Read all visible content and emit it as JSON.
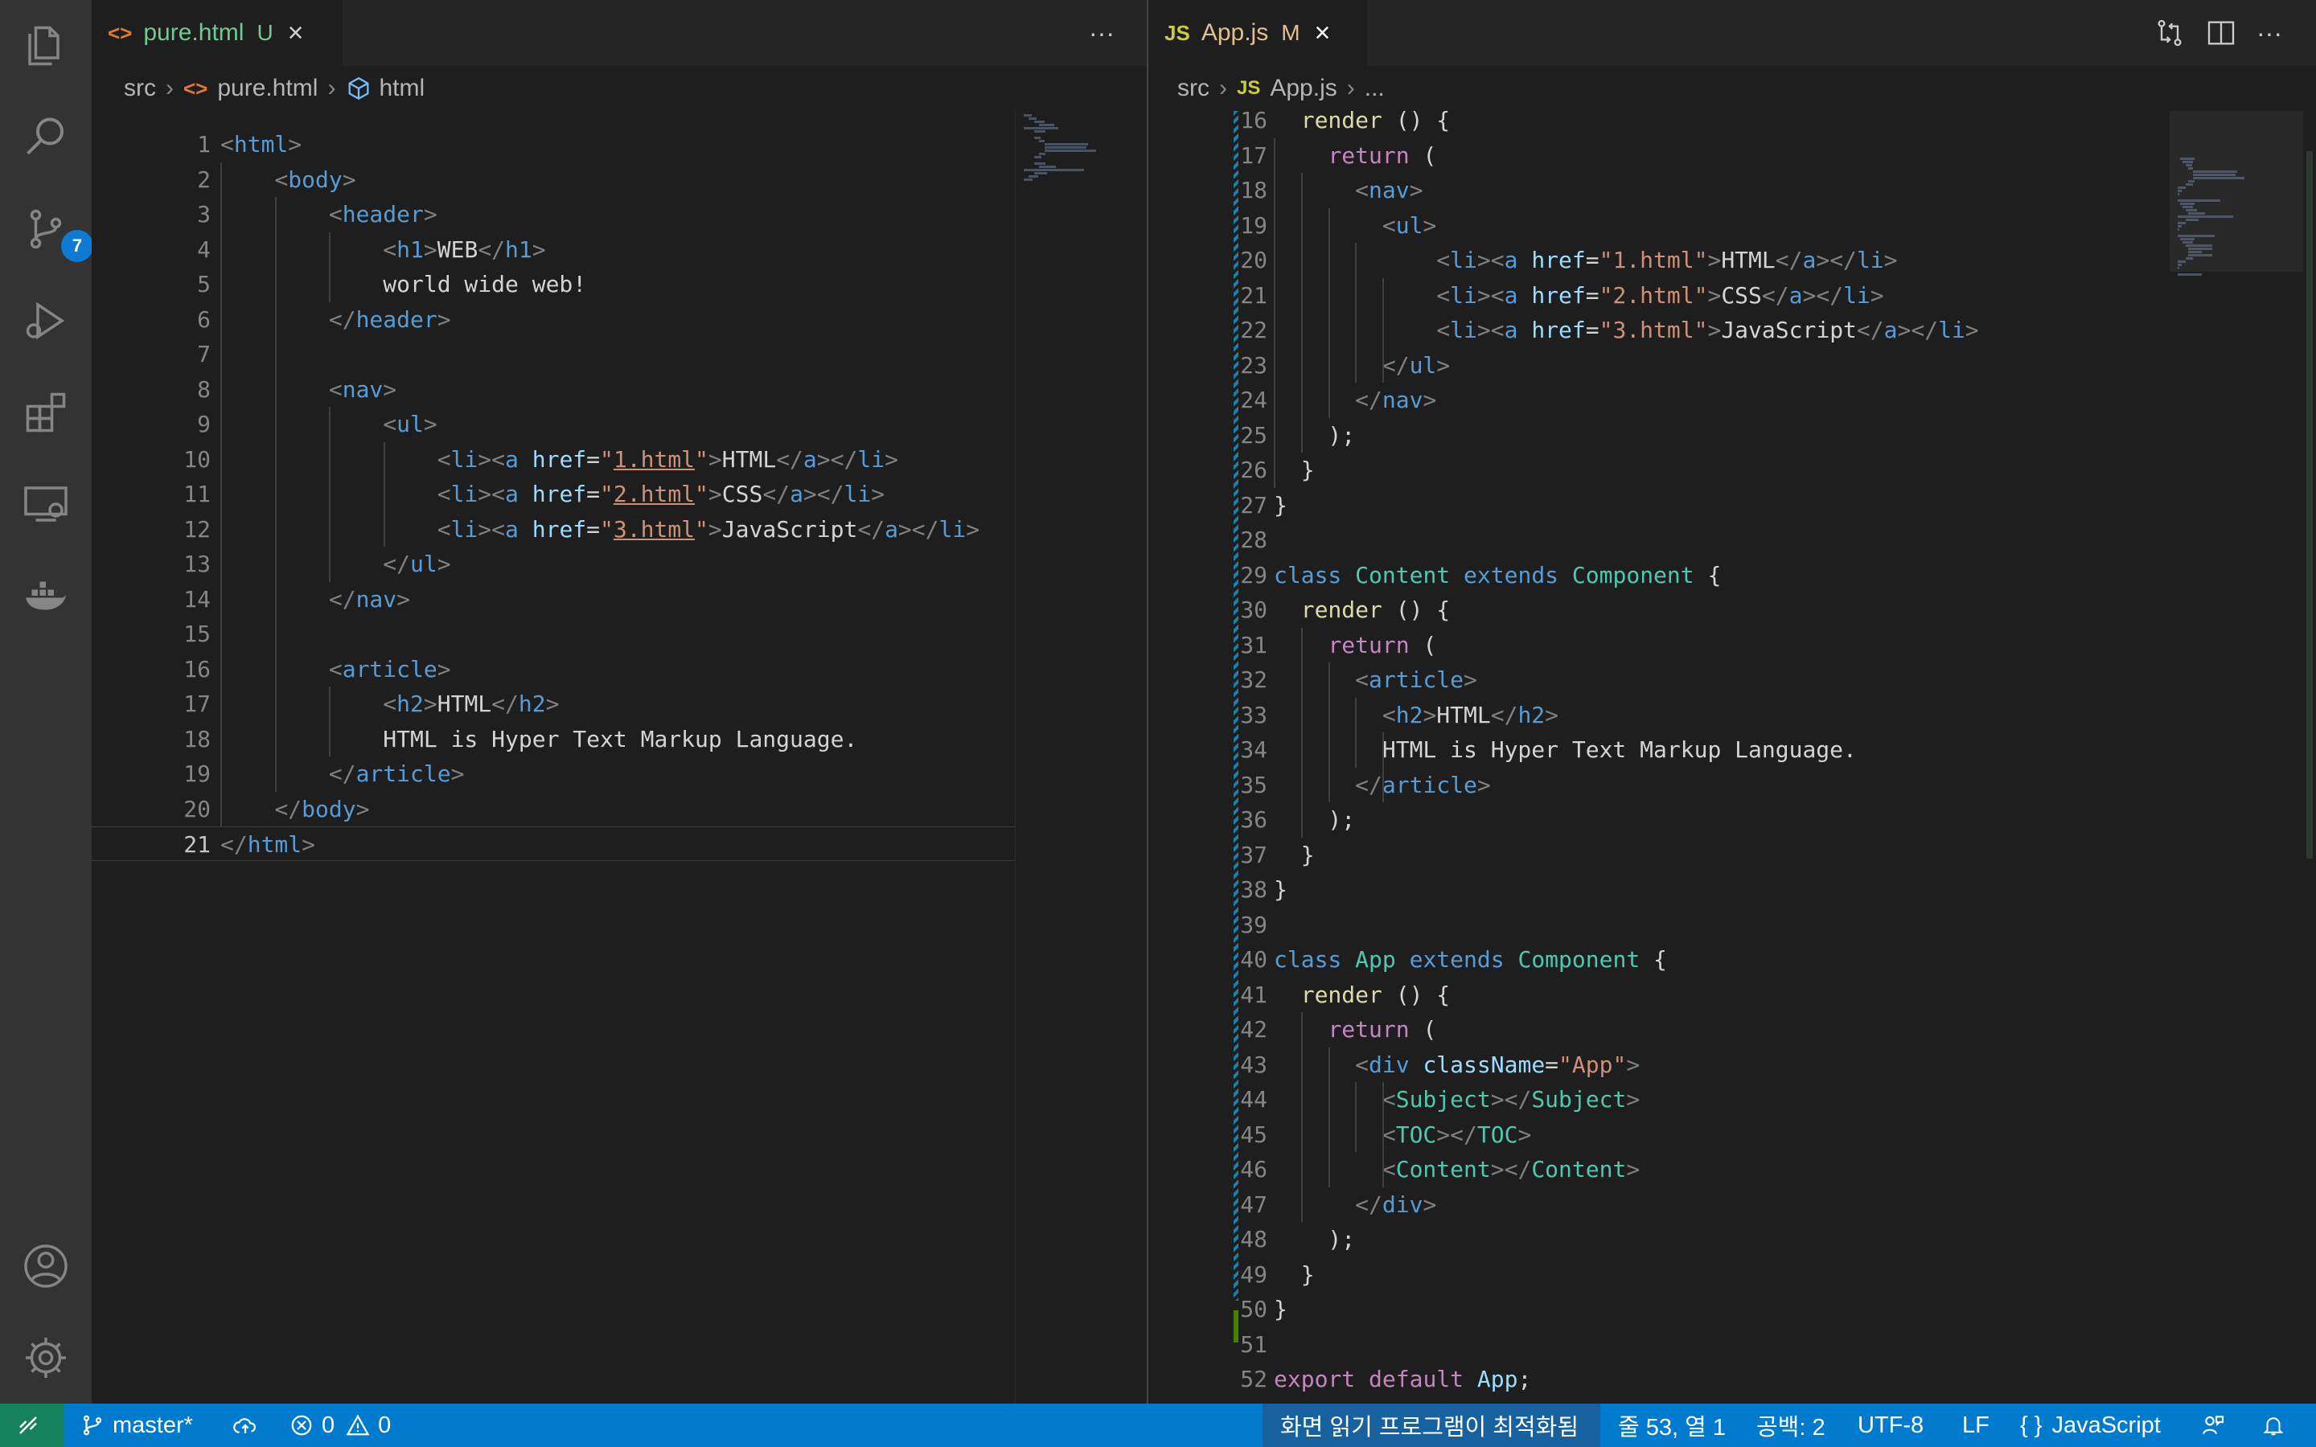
{
  "activity_bar": {
    "source_control_badge": "7"
  },
  "left_editor": {
    "tab": {
      "icon": "<>",
      "filename": "pure.html",
      "status": "U"
    },
    "more_actions": "···",
    "breadcrumb": {
      "folder": "src",
      "file": "pure.html",
      "symbol": "html"
    },
    "active_line": 21,
    "lines": [
      [
        {
          "c": "br",
          "t": "<"
        },
        {
          "c": "t",
          "t": "html"
        },
        {
          "c": "br",
          "t": ">"
        }
      ],
      [
        {
          "c": "pl",
          "t": "    "
        },
        {
          "c": "br",
          "t": "<"
        },
        {
          "c": "t",
          "t": "body"
        },
        {
          "c": "br",
          "t": ">"
        }
      ],
      [
        {
          "c": "pl",
          "t": "        "
        },
        {
          "c": "br",
          "t": "<"
        },
        {
          "c": "t",
          "t": "header"
        },
        {
          "c": "br",
          "t": ">"
        }
      ],
      [
        {
          "c": "pl",
          "t": "            "
        },
        {
          "c": "br",
          "t": "<"
        },
        {
          "c": "t",
          "t": "h1"
        },
        {
          "c": "br",
          "t": ">"
        },
        {
          "c": "pl",
          "t": "WEB"
        },
        {
          "c": "br",
          "t": "</"
        },
        {
          "c": "t",
          "t": "h1"
        },
        {
          "c": "br",
          "t": ">"
        }
      ],
      [
        {
          "c": "pl",
          "t": "            world wide web!"
        }
      ],
      [
        {
          "c": "pl",
          "t": "        "
        },
        {
          "c": "br",
          "t": "</"
        },
        {
          "c": "t",
          "t": "header"
        },
        {
          "c": "br",
          "t": ">"
        }
      ],
      [],
      [
        {
          "c": "pl",
          "t": "        "
        },
        {
          "c": "br",
          "t": "<"
        },
        {
          "c": "t",
          "t": "nav"
        },
        {
          "c": "br",
          "t": ">"
        }
      ],
      [
        {
          "c": "pl",
          "t": "            "
        },
        {
          "c": "br",
          "t": "<"
        },
        {
          "c": "t",
          "t": "ul"
        },
        {
          "c": "br",
          "t": ">"
        }
      ],
      [
        {
          "c": "pl",
          "t": "                "
        },
        {
          "c": "br",
          "t": "<"
        },
        {
          "c": "t",
          "t": "li"
        },
        {
          "c": "br",
          "t": "><"
        },
        {
          "c": "t",
          "t": "a"
        },
        {
          "c": "pl",
          "t": " "
        },
        {
          "c": "at",
          "t": "href"
        },
        {
          "c": "pl",
          "t": "="
        },
        {
          "c": "st",
          "t": "\""
        },
        {
          "c": "st ul",
          "t": "1.html"
        },
        {
          "c": "st",
          "t": "\""
        },
        {
          "c": "br",
          "t": ">"
        },
        {
          "c": "pl",
          "t": "HTML"
        },
        {
          "c": "br",
          "t": "</"
        },
        {
          "c": "t",
          "t": "a"
        },
        {
          "c": "br",
          "t": "></"
        },
        {
          "c": "t",
          "t": "li"
        },
        {
          "c": "br",
          "t": ">"
        }
      ],
      [
        {
          "c": "pl",
          "t": "                "
        },
        {
          "c": "br",
          "t": "<"
        },
        {
          "c": "t",
          "t": "li"
        },
        {
          "c": "br",
          "t": "><"
        },
        {
          "c": "t",
          "t": "a"
        },
        {
          "c": "pl",
          "t": " "
        },
        {
          "c": "at",
          "t": "href"
        },
        {
          "c": "pl",
          "t": "="
        },
        {
          "c": "st",
          "t": "\""
        },
        {
          "c": "st ul",
          "t": "2.html"
        },
        {
          "c": "st",
          "t": "\""
        },
        {
          "c": "br",
          "t": ">"
        },
        {
          "c": "pl",
          "t": "CSS"
        },
        {
          "c": "br",
          "t": "</"
        },
        {
          "c": "t",
          "t": "a"
        },
        {
          "c": "br",
          "t": "></"
        },
        {
          "c": "t",
          "t": "li"
        },
        {
          "c": "br",
          "t": ">"
        }
      ],
      [
        {
          "c": "pl",
          "t": "                "
        },
        {
          "c": "br",
          "t": "<"
        },
        {
          "c": "t",
          "t": "li"
        },
        {
          "c": "br",
          "t": "><"
        },
        {
          "c": "t",
          "t": "a"
        },
        {
          "c": "pl",
          "t": " "
        },
        {
          "c": "at",
          "t": "href"
        },
        {
          "c": "pl",
          "t": "="
        },
        {
          "c": "st",
          "t": "\""
        },
        {
          "c": "st ul",
          "t": "3.html"
        },
        {
          "c": "st",
          "t": "\""
        },
        {
          "c": "br",
          "t": ">"
        },
        {
          "c": "pl",
          "t": "JavaScript"
        },
        {
          "c": "br",
          "t": "</"
        },
        {
          "c": "t",
          "t": "a"
        },
        {
          "c": "br",
          "t": "></"
        },
        {
          "c": "t",
          "t": "li"
        },
        {
          "c": "br",
          "t": ">"
        }
      ],
      [
        {
          "c": "pl",
          "t": "            "
        },
        {
          "c": "br",
          "t": "</"
        },
        {
          "c": "t",
          "t": "ul"
        },
        {
          "c": "br",
          "t": ">"
        }
      ],
      [
        {
          "c": "pl",
          "t": "        "
        },
        {
          "c": "br",
          "t": "</"
        },
        {
          "c": "t",
          "t": "nav"
        },
        {
          "c": "br",
          "t": ">"
        }
      ],
      [],
      [
        {
          "c": "pl",
          "t": "        "
        },
        {
          "c": "br",
          "t": "<"
        },
        {
          "c": "t",
          "t": "article"
        },
        {
          "c": "br",
          "t": ">"
        }
      ],
      [
        {
          "c": "pl",
          "t": "            "
        },
        {
          "c": "br",
          "t": "<"
        },
        {
          "c": "t",
          "t": "h2"
        },
        {
          "c": "br",
          "t": ">"
        },
        {
          "c": "pl",
          "t": "HTML"
        },
        {
          "c": "br",
          "t": "</"
        },
        {
          "c": "t",
          "t": "h2"
        },
        {
          "c": "br",
          "t": ">"
        }
      ],
      [
        {
          "c": "pl",
          "t": "            HTML is Hyper Text Markup Language."
        }
      ],
      [
        {
          "c": "pl",
          "t": "        "
        },
        {
          "c": "br",
          "t": "</"
        },
        {
          "c": "t",
          "t": "article"
        },
        {
          "c": "br",
          "t": ">"
        }
      ],
      [
        {
          "c": "pl",
          "t": "    "
        },
        {
          "c": "br",
          "t": "</"
        },
        {
          "c": "t",
          "t": "body"
        },
        {
          "c": "br",
          "t": ">"
        }
      ],
      [
        {
          "c": "br",
          "t": "</"
        },
        {
          "c": "t",
          "t": "html"
        },
        {
          "c": "br",
          "t": ">"
        }
      ]
    ]
  },
  "right_editor": {
    "tab": {
      "icon": "JS",
      "filename": "App.js",
      "status": "M"
    },
    "more_actions": "···",
    "breadcrumb": {
      "folder": "src",
      "file_icon": "JS",
      "file": "App.js",
      "symbol": "..."
    },
    "first_line": 16,
    "lines": [
      [
        {
          "c": "pl",
          "t": "  "
        },
        {
          "c": "fn",
          "t": "render"
        },
        {
          "c": "pl",
          "t": " () {"
        }
      ],
      [
        {
          "c": "pl",
          "t": "    "
        },
        {
          "c": "kw",
          "t": "return"
        },
        {
          "c": "pl",
          "t": " ("
        }
      ],
      [
        {
          "c": "pl",
          "t": "      "
        },
        {
          "c": "br",
          "t": "<"
        },
        {
          "c": "t",
          "t": "nav"
        },
        {
          "c": "br",
          "t": ">"
        }
      ],
      [
        {
          "c": "pl",
          "t": "        "
        },
        {
          "c": "br",
          "t": "<"
        },
        {
          "c": "t",
          "t": "ul"
        },
        {
          "c": "br",
          "t": ">"
        }
      ],
      [
        {
          "c": "pl",
          "t": "            "
        },
        {
          "c": "br",
          "t": "<"
        },
        {
          "c": "t",
          "t": "li"
        },
        {
          "c": "br",
          "t": "><"
        },
        {
          "c": "t",
          "t": "a"
        },
        {
          "c": "pl",
          "t": " "
        },
        {
          "c": "at",
          "t": "href"
        },
        {
          "c": "pl",
          "t": "="
        },
        {
          "c": "st",
          "t": "\"1.html\""
        },
        {
          "c": "br",
          "t": ">"
        },
        {
          "c": "pl",
          "t": "HTML"
        },
        {
          "c": "br",
          "t": "</"
        },
        {
          "c": "t",
          "t": "a"
        },
        {
          "c": "br",
          "t": "></"
        },
        {
          "c": "t",
          "t": "li"
        },
        {
          "c": "br",
          "t": ">"
        }
      ],
      [
        {
          "c": "pl",
          "t": "            "
        },
        {
          "c": "br",
          "t": "<"
        },
        {
          "c": "t",
          "t": "li"
        },
        {
          "c": "br",
          "t": "><"
        },
        {
          "c": "t",
          "t": "a"
        },
        {
          "c": "pl",
          "t": " "
        },
        {
          "c": "at",
          "t": "href"
        },
        {
          "c": "pl",
          "t": "="
        },
        {
          "c": "st",
          "t": "\"2.html\""
        },
        {
          "c": "br",
          "t": ">"
        },
        {
          "c": "pl",
          "t": "CSS"
        },
        {
          "c": "br",
          "t": "</"
        },
        {
          "c": "t",
          "t": "a"
        },
        {
          "c": "br",
          "t": "></"
        },
        {
          "c": "t",
          "t": "li"
        },
        {
          "c": "br",
          "t": ">"
        }
      ],
      [
        {
          "c": "pl",
          "t": "            "
        },
        {
          "c": "br",
          "t": "<"
        },
        {
          "c": "t",
          "t": "li"
        },
        {
          "c": "br",
          "t": "><"
        },
        {
          "c": "t",
          "t": "a"
        },
        {
          "c": "pl",
          "t": " "
        },
        {
          "c": "at",
          "t": "href"
        },
        {
          "c": "pl",
          "t": "="
        },
        {
          "c": "st",
          "t": "\"3.html\""
        },
        {
          "c": "br",
          "t": ">"
        },
        {
          "c": "pl",
          "t": "JavaScript"
        },
        {
          "c": "br",
          "t": "</"
        },
        {
          "c": "t",
          "t": "a"
        },
        {
          "c": "br",
          "t": "></"
        },
        {
          "c": "t",
          "t": "li"
        },
        {
          "c": "br",
          "t": ">"
        }
      ],
      [
        {
          "c": "pl",
          "t": "        "
        },
        {
          "c": "br",
          "t": "</"
        },
        {
          "c": "t",
          "t": "ul"
        },
        {
          "c": "br",
          "t": ">"
        }
      ],
      [
        {
          "c": "pl",
          "t": "      "
        },
        {
          "c": "br",
          "t": "</"
        },
        {
          "c": "t",
          "t": "nav"
        },
        {
          "c": "br",
          "t": ">"
        }
      ],
      [
        {
          "c": "pl",
          "t": "    );"
        }
      ],
      [
        {
          "c": "pl",
          "t": "  }"
        }
      ],
      [
        {
          "c": "pl",
          "t": "}"
        }
      ],
      [],
      [
        {
          "c": "ky",
          "t": "class"
        },
        {
          "c": "pl",
          "t": " "
        },
        {
          "c": "cl",
          "t": "Content"
        },
        {
          "c": "pl",
          "t": " "
        },
        {
          "c": "ky",
          "t": "extends"
        },
        {
          "c": "pl",
          "t": " "
        },
        {
          "c": "cl",
          "t": "Component"
        },
        {
          "c": "pl",
          "t": " {"
        }
      ],
      [
        {
          "c": "pl",
          "t": "  "
        },
        {
          "c": "fn",
          "t": "render"
        },
        {
          "c": "pl",
          "t": " () {"
        }
      ],
      [
        {
          "c": "pl",
          "t": "    "
        },
        {
          "c": "kw",
          "t": "return"
        },
        {
          "c": "pl",
          "t": " ("
        }
      ],
      [
        {
          "c": "pl",
          "t": "      "
        },
        {
          "c": "br",
          "t": "<"
        },
        {
          "c": "t",
          "t": "article"
        },
        {
          "c": "br",
          "t": ">"
        }
      ],
      [
        {
          "c": "pl",
          "t": "        "
        },
        {
          "c": "br",
          "t": "<"
        },
        {
          "c": "t",
          "t": "h2"
        },
        {
          "c": "br",
          "t": ">"
        },
        {
          "c": "pl",
          "t": "HTML"
        },
        {
          "c": "br",
          "t": "</"
        },
        {
          "c": "t",
          "t": "h2"
        },
        {
          "c": "br",
          "t": ">"
        }
      ],
      [
        {
          "c": "pl",
          "t": "        HTML is Hyper Text Markup Language."
        }
      ],
      [
        {
          "c": "pl",
          "t": "      "
        },
        {
          "c": "br",
          "t": "</"
        },
        {
          "c": "t",
          "t": "article"
        },
        {
          "c": "br",
          "t": ">"
        }
      ],
      [
        {
          "c": "pl",
          "t": "    );"
        }
      ],
      [
        {
          "c": "pl",
          "t": "  }"
        }
      ],
      [
        {
          "c": "pl",
          "t": "}"
        }
      ],
      [],
      [
        {
          "c": "ky",
          "t": "class"
        },
        {
          "c": "pl",
          "t": " "
        },
        {
          "c": "cl",
          "t": "App"
        },
        {
          "c": "pl",
          "t": " "
        },
        {
          "c": "ky",
          "t": "extends"
        },
        {
          "c": "pl",
          "t": " "
        },
        {
          "c": "cl",
          "t": "Component"
        },
        {
          "c": "pl",
          "t": " {"
        }
      ],
      [
        {
          "c": "pl",
          "t": "  "
        },
        {
          "c": "fn",
          "t": "render"
        },
        {
          "c": "pl",
          "t": " () {"
        }
      ],
      [
        {
          "c": "pl",
          "t": "    "
        },
        {
          "c": "kw",
          "t": "return"
        },
        {
          "c": "pl",
          "t": " ("
        }
      ],
      [
        {
          "c": "pl",
          "t": "      "
        },
        {
          "c": "br",
          "t": "<"
        },
        {
          "c": "t",
          "t": "div"
        },
        {
          "c": "pl",
          "t": " "
        },
        {
          "c": "at",
          "t": "className"
        },
        {
          "c": "pl",
          "t": "="
        },
        {
          "c": "st",
          "t": "\"App\""
        },
        {
          "c": "br",
          "t": ">"
        }
      ],
      [
        {
          "c": "pl",
          "t": "        "
        },
        {
          "c": "br",
          "t": "<"
        },
        {
          "c": "cl",
          "t": "Subject"
        },
        {
          "c": "br",
          "t": "></"
        },
        {
          "c": "cl",
          "t": "Subject"
        },
        {
          "c": "br",
          "t": ">"
        }
      ],
      [
        {
          "c": "pl",
          "t": "        "
        },
        {
          "c": "br",
          "t": "<"
        },
        {
          "c": "cl",
          "t": "TOC"
        },
        {
          "c": "br",
          "t": "></"
        },
        {
          "c": "cl",
          "t": "TOC"
        },
        {
          "c": "br",
          "t": ">"
        }
      ],
      [
        {
          "c": "pl",
          "t": "        "
        },
        {
          "c": "br",
          "t": "<"
        },
        {
          "c": "cl",
          "t": "Content"
        },
        {
          "c": "br",
          "t": "></"
        },
        {
          "c": "cl",
          "t": "Content"
        },
        {
          "c": "br",
          "t": ">"
        }
      ],
      [
        {
          "c": "pl",
          "t": "      "
        },
        {
          "c": "br",
          "t": "</"
        },
        {
          "c": "t",
          "t": "div"
        },
        {
          "c": "br",
          "t": ">"
        }
      ],
      [
        {
          "c": "pl",
          "t": "    );"
        }
      ],
      [
        {
          "c": "pl",
          "t": "  }"
        }
      ],
      [
        {
          "c": "pl",
          "t": "}"
        }
      ],
      [],
      [
        {
          "c": "kw",
          "t": "export"
        },
        {
          "c": "pl",
          "t": " "
        },
        {
          "c": "kw",
          "t": "default"
        },
        {
          "c": "pl",
          "t": " "
        },
        {
          "c": "vr",
          "t": "App"
        },
        {
          "c": "pl",
          "t": ";"
        }
      ]
    ]
  },
  "status_bar": {
    "branch": "master*",
    "errors": "0",
    "warnings": "0",
    "screen_reader": "화면 읽기 프로그램이 최적화됨",
    "cursor_position": "줄 53, 열 1",
    "indentation": "공백: 2",
    "encoding": "UTF-8",
    "eol": "LF",
    "language_icon": "{ }",
    "language": "JavaScript"
  },
  "colors": {
    "activity_bar": "#333333",
    "editor_bg": "#1e1e1e",
    "status_bar": "#007acc",
    "html_icon": "#e37933",
    "js_icon": "#cbcb41",
    "untracked": "#73c991",
    "modified": "#e2c08d"
  }
}
